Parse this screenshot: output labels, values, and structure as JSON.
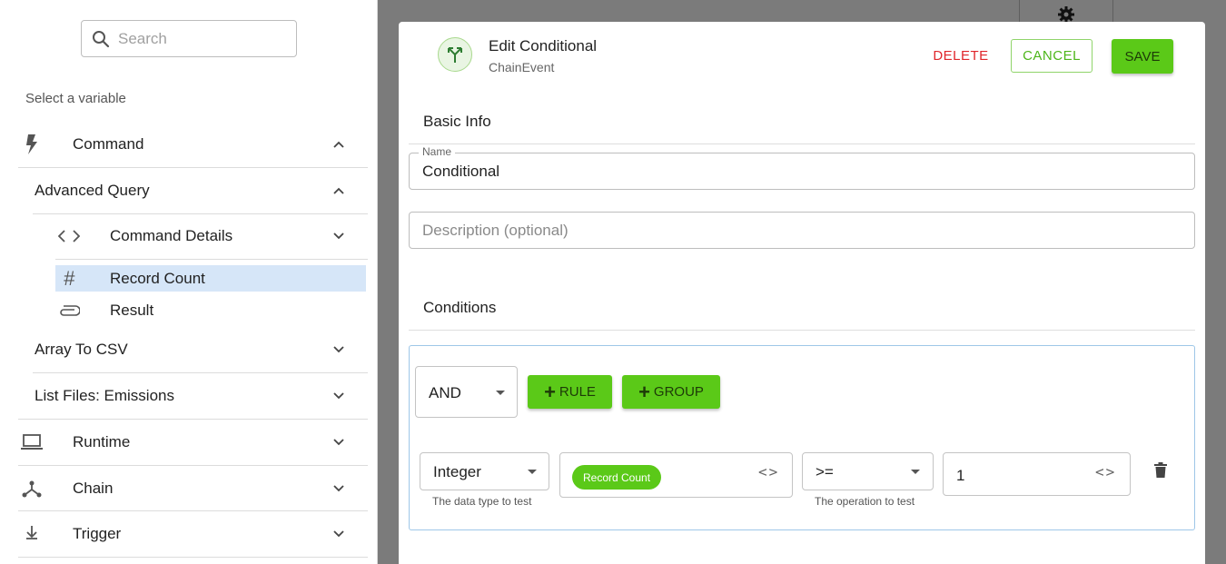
{
  "sidebar": {
    "search_placeholder": "Search",
    "select_label": "Select a variable",
    "items": [
      {
        "label": "Command",
        "icon": "lightning-icon"
      },
      {
        "label": "Advanced Query"
      },
      {
        "label": "Command Details",
        "icon": "code-icon"
      },
      {
        "label": "Record Count",
        "icon": "hash-icon",
        "selected": true
      },
      {
        "label": "Result",
        "icon": "paperclip-icon"
      },
      {
        "label": "Array To CSV"
      },
      {
        "label": "List Files: Emissions"
      },
      {
        "label": "Runtime",
        "icon": "laptop-icon"
      },
      {
        "label": "Chain",
        "icon": "chain-icon"
      },
      {
        "label": "Trigger",
        "icon": "download-icon"
      }
    ]
  },
  "modal": {
    "title": "Edit Conditional",
    "subtitle": "ChainEvent",
    "delete_label": "DELETE",
    "cancel_label": "CANCEL",
    "save_label": "SAVE",
    "basic_info_title": "Basic Info",
    "name_label": "Name",
    "name_value": "Conditional",
    "description_placeholder": "Description (optional)",
    "conditions_title": "Conditions",
    "combinator": "AND",
    "add_rule_label": "RULE",
    "add_group_label": "GROUP",
    "rule": {
      "type_value": "Integer",
      "type_helper": "The data type to test",
      "variable_chip": "Record Count",
      "operator_value": ">=",
      "operator_helper": "The operation to test",
      "compare_value": "1"
    }
  },
  "colors": {
    "accent_green": "#5bc918",
    "danger_red": "#e0262b",
    "selected_bg": "#d6e6f8"
  }
}
